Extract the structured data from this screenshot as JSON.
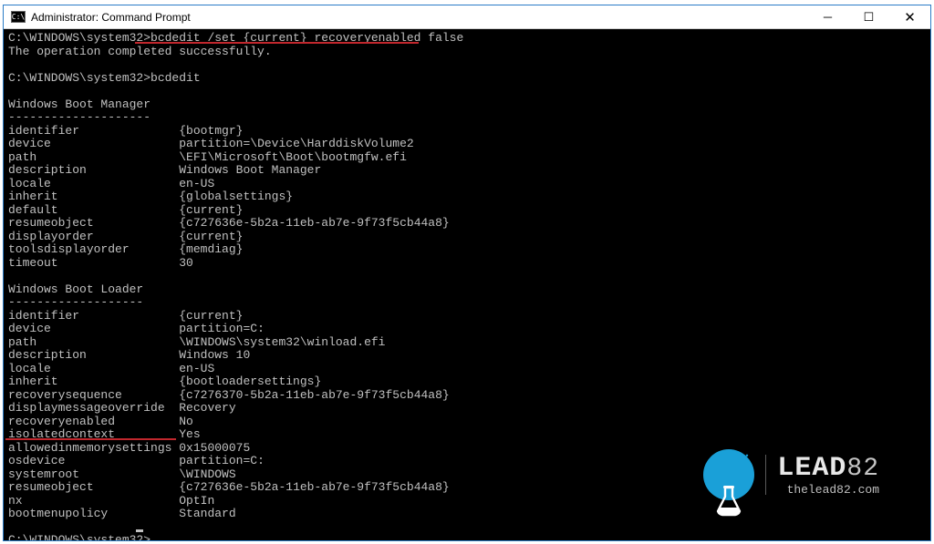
{
  "titlebar": {
    "icon_text": "C:\\",
    "title": "Administrator: Command Prompt"
  },
  "terminal": {
    "prompt": "C:\\WINDOWS\\system32>",
    "cmd1": "bcdedit /set {current} recoveryenabled false",
    "result1": "The operation completed successfully.",
    "cmd2": "bcdedit",
    "section1": "Windows Boot Manager",
    "dashes": "--------------------",
    "bm": {
      "identifier": "{bootmgr}",
      "device": "partition=\\Device\\HarddiskVolume2",
      "path": "\\EFI\\Microsoft\\Boot\\bootmgfw.efi",
      "description": "Windows Boot Manager",
      "locale": "en-US",
      "inherit": "{globalsettings}",
      "default": "{current}",
      "resumeobject": "{c727636e-5b2a-11eb-ab7e-9f73f5cb44a8}",
      "displayorder": "{current}",
      "toolsdisplayorder": "{memdiag}",
      "timeout": "30"
    },
    "section2": "Windows Boot Loader",
    "dashes2": "-------------------",
    "bl": {
      "identifier": "{current}",
      "device": "partition=C:",
      "path": "\\WINDOWS\\system32\\winload.efi",
      "description": "Windows 10",
      "locale": "en-US",
      "inherit": "{bootloadersettings}",
      "recoverysequence": "{c7276370-5b2a-11eb-ab7e-9f73f5cb44a8}",
      "displaymessageoverride": "Recovery",
      "recoveryenabled": "No",
      "isolatedcontext": "Yes",
      "allowedinmemorysettings": "0x15000075",
      "osdevice": "partition=C:",
      "systemroot": "\\WINDOWS",
      "resumeobject": "{c727636e-5b2a-11eb-ab7e-9f73f5cb44a8}",
      "nx": "OptIn",
      "bootmenupolicy": "Standard"
    }
  },
  "labels": {
    "identifier": "identifier",
    "device": "device",
    "path": "path",
    "description": "description",
    "locale": "locale",
    "inherit": "inherit",
    "default": "default",
    "resumeobject": "resumeobject",
    "displayorder": "displayorder",
    "toolsdisplayorder": "toolsdisplayorder",
    "timeout": "timeout",
    "recoverysequence": "recoverysequence",
    "displaymessageoverride": "displaymessageoverride",
    "recoveryenabled": "recoveryenabled",
    "isolatedcontext": "isolatedcontext",
    "allowedinmemorysettings": "allowedinmemorysettings",
    "osdevice": "osdevice",
    "systemroot": "systemroot",
    "nx": "nx",
    "bootmenupolicy": "bootmenupolicy"
  },
  "logo": {
    "name_bold": "LEAD",
    "name_light": "82",
    "url": "thelead82.com"
  }
}
